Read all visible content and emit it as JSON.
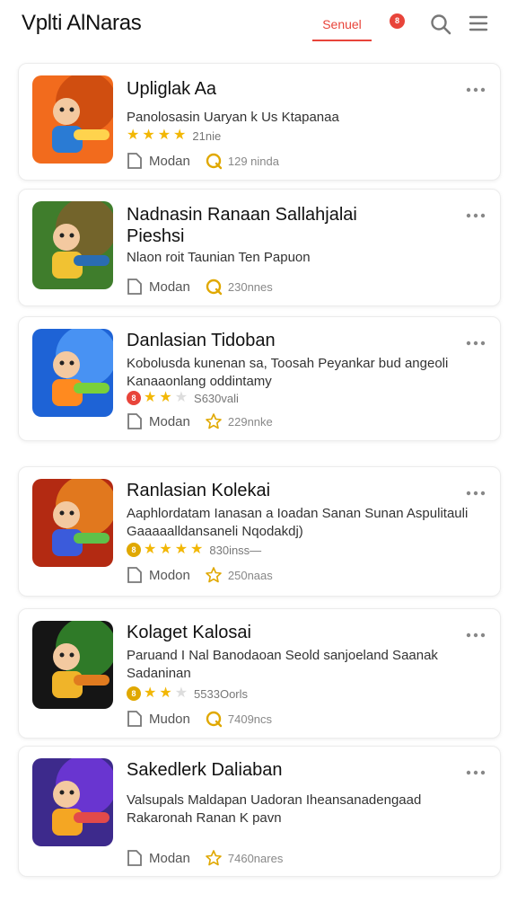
{
  "header": {
    "title": "Vplti AlNaras",
    "tab_label": "Senuel",
    "notification_count": "8",
    "icons": [
      "search-icon",
      "menu-icon"
    ],
    "accent_color": "#e8443a"
  },
  "items": [
    {
      "title_lines": [
        "Upliglak Aa"
      ],
      "desc_lines": [
        "Panolosasin Uaryan k Us Ktapanaa"
      ],
      "rating_prefix": "",
      "stars": 4,
      "rating_text": "21nie",
      "meta_label": "Modan",
      "stat_icon": "refresh-icon",
      "stat_count": "129 ninda",
      "thumb_theme": "orange"
    },
    {
      "title_lines": [
        "Nadnasin Ranaan Sallahjalai",
        "Pieshsi"
      ],
      "desc_lines": [
        "Nlaon roit Taunian Ten Papuon"
      ],
      "rating_prefix": "",
      "stars": 0,
      "rating_text": "",
      "meta_label": "Modan",
      "stat_icon": "refresh-icon",
      "stat_count": "230nnes",
      "thumb_theme": "green"
    },
    {
      "title_lines": [
        "Danlasian Tidoban"
      ],
      "desc_lines": [
        "Kobolusda kunenan sa, Toosah Peyankar bud angeoli",
        "Kanaaonlang oddintamy"
      ],
      "rating_prefix": "8",
      "stars": 2,
      "rating_text": "S630vali",
      "meta_label": "Modan",
      "stat_icon": "star-outline-icon",
      "stat_count": "229nnke",
      "thumb_theme": "blue"
    },
    {
      "title_lines": [
        "Ranlasian Kolekai"
      ],
      "desc_lines": [
        "Aaphlordatam Ianasan a Ioadan Sanan Sunan Aspulitauli",
        "Gaaaaalldansaneli Nqodakdj)"
      ],
      "rating_prefix": "8",
      "stars": 4,
      "rating_text": "830inss—",
      "meta_label": "Modon",
      "stat_icon": "star-outline-icon",
      "stat_count": "250naas",
      "thumb_theme": "fire"
    },
    {
      "title_lines": [
        "Kolaget Kalosai"
      ],
      "desc_lines": [
        "Paruand I Nal Banodaoan Seold sanjoeland Saanak",
        "Sadaninan"
      ],
      "rating_prefix": "8",
      "stars": 2,
      "rating_text": "5533Oorls",
      "meta_label": "Mudon",
      "stat_icon": "refresh-icon",
      "stat_count": "7409ncs",
      "thumb_theme": "dark"
    },
    {
      "title_lines": [
        "Sakedlerk Daliaban"
      ],
      "desc_lines": [
        "Valsupals Maldapan Uadoran Iheansanadengaad",
        "Rakaronah Ranan K pavn"
      ],
      "rating_prefix": "",
      "stars": 0,
      "rating_text": "",
      "meta_label": "Modan",
      "stat_icon": "star-outline-icon",
      "stat_count": "7460nares",
      "thumb_theme": "purple"
    }
  ]
}
